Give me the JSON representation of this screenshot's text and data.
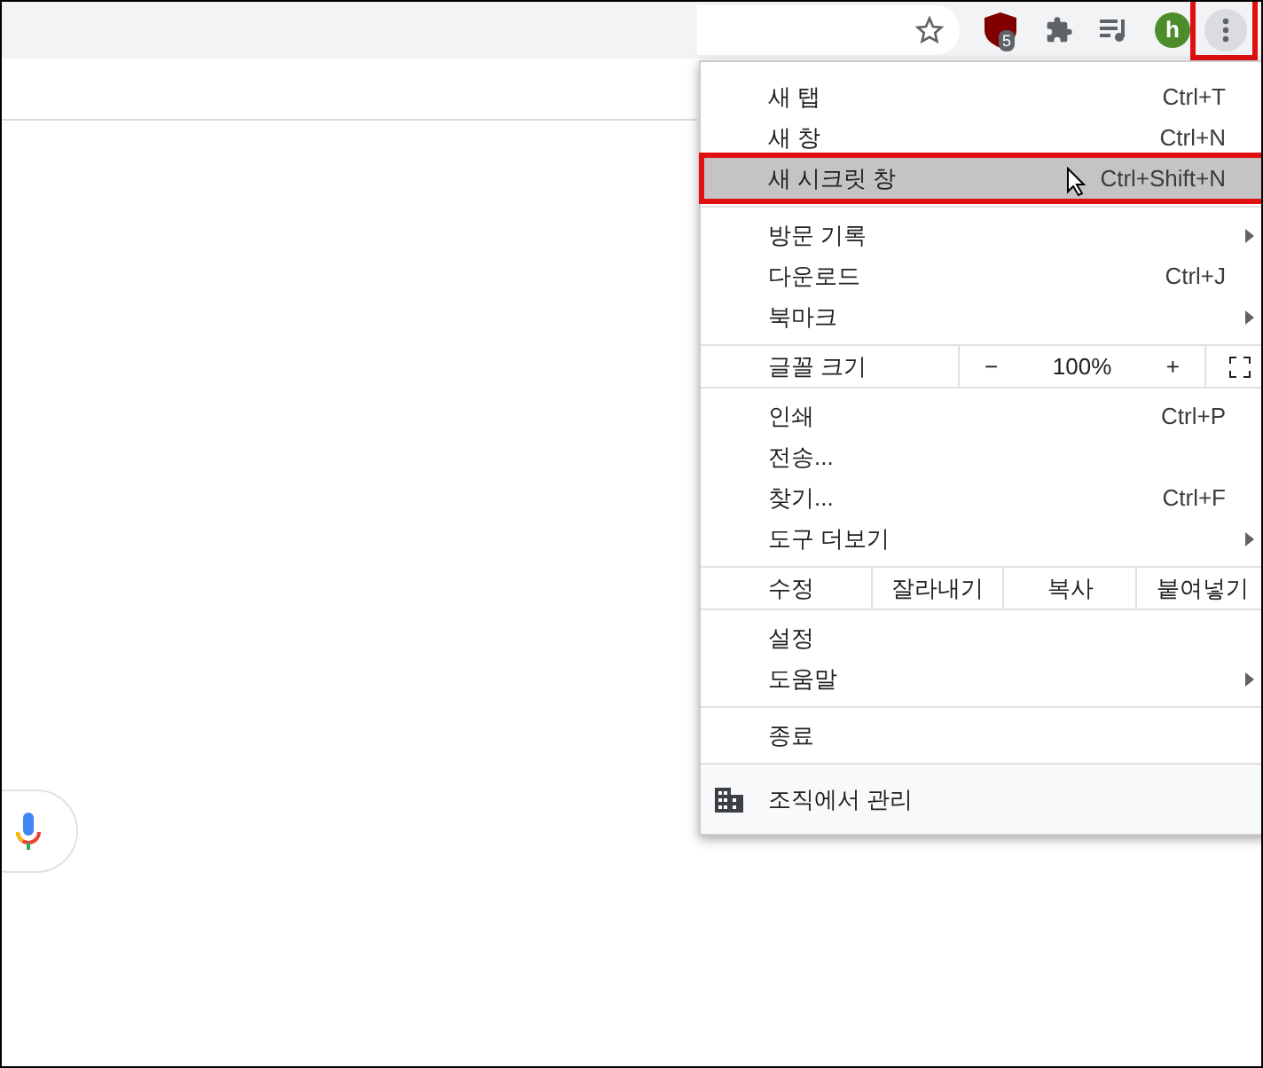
{
  "toolbar": {
    "extension_badge": "5",
    "avatar_letter": "h",
    "menu_button": {
      "annotated": true
    }
  },
  "menu": {
    "groups": [
      [
        {
          "kind": "item",
          "label": "새 탭",
          "shortcut": "Ctrl+T",
          "submenu": false,
          "selected": false,
          "annotated": false
        },
        {
          "kind": "item",
          "label": "새 창",
          "shortcut": "Ctrl+N",
          "submenu": false,
          "selected": false,
          "annotated": false
        },
        {
          "kind": "item",
          "label": "새 시크릿 창",
          "shortcut": "Ctrl+Shift+N",
          "submenu": false,
          "selected": true,
          "annotated": true
        }
      ],
      [
        {
          "kind": "item",
          "label": "방문 기록",
          "submenu": true,
          "selected": false,
          "annotated": false
        },
        {
          "kind": "item",
          "label": "다운로드",
          "shortcut": "Ctrl+J",
          "submenu": false,
          "selected": false,
          "annotated": false
        },
        {
          "kind": "item",
          "label": "북마크",
          "submenu": true,
          "selected": false,
          "annotated": false
        }
      ],
      [
        {
          "kind": "zoom",
          "label": "글꼴 크기",
          "minus": "−",
          "value": "100%",
          "plus": "+"
        }
      ],
      [
        {
          "kind": "item",
          "label": "인쇄",
          "shortcut": "Ctrl+P",
          "submenu": false,
          "selected": false,
          "annotated": false
        },
        {
          "kind": "item",
          "label": "전송...",
          "submenu": false,
          "selected": false,
          "annotated": false
        },
        {
          "kind": "item",
          "label": "찾기...",
          "shortcut": "Ctrl+F",
          "submenu": false,
          "selected": false,
          "annotated": false
        },
        {
          "kind": "item",
          "label": "도구 더보기",
          "submenu": true,
          "selected": false,
          "annotated": false
        }
      ],
      [
        {
          "kind": "edit",
          "label": "수정",
          "actions": [
            "잘라내기",
            "복사",
            "붙여넣기"
          ]
        }
      ],
      [
        {
          "kind": "item",
          "label": "설정",
          "submenu": false,
          "selected": false,
          "annotated": false
        },
        {
          "kind": "item",
          "label": "도움말",
          "submenu": true,
          "selected": false,
          "annotated": false
        }
      ],
      [
        {
          "kind": "item",
          "label": "종료",
          "submenu": false,
          "selected": false,
          "annotated": false
        }
      ]
    ],
    "footer": {
      "label": "조직에서 관리"
    }
  }
}
